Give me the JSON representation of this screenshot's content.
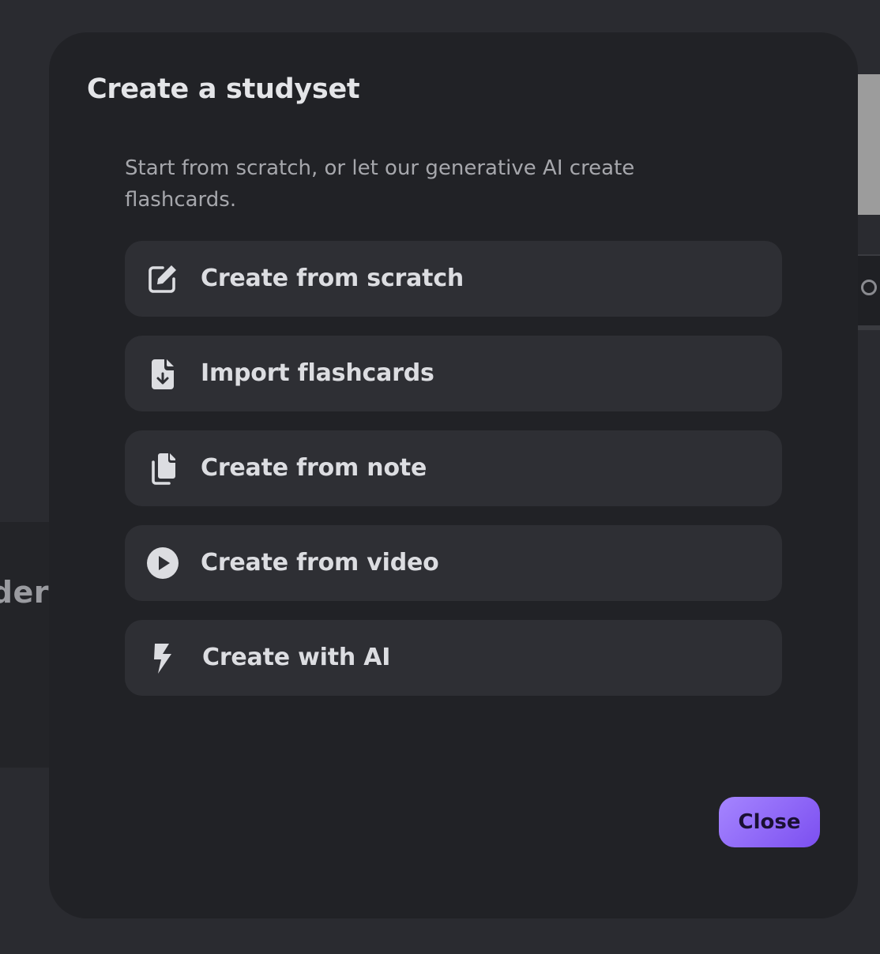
{
  "background": {
    "left_text": "der"
  },
  "modal": {
    "title": "Create a studyset",
    "subtitle": "Start from scratch, or let our generative AI create flashcards.",
    "options": [
      {
        "label": "Create from scratch",
        "icon": "edit-icon"
      },
      {
        "label": "Import flashcards",
        "icon": "file-import-icon"
      },
      {
        "label": "Create from note",
        "icon": "copy-documents-icon"
      },
      {
        "label": "Create from video",
        "icon": "play-circle-icon"
      },
      {
        "label": "Create with AI",
        "icon": "lightning-bolt-icon"
      }
    ],
    "close_label": "Close"
  },
  "colors": {
    "modal_bg": "#212226",
    "option_bg": "#2e2f34",
    "accent": "#8b5cf6",
    "text_primary": "#dcdde1",
    "text_secondary": "#a6a7ac"
  }
}
